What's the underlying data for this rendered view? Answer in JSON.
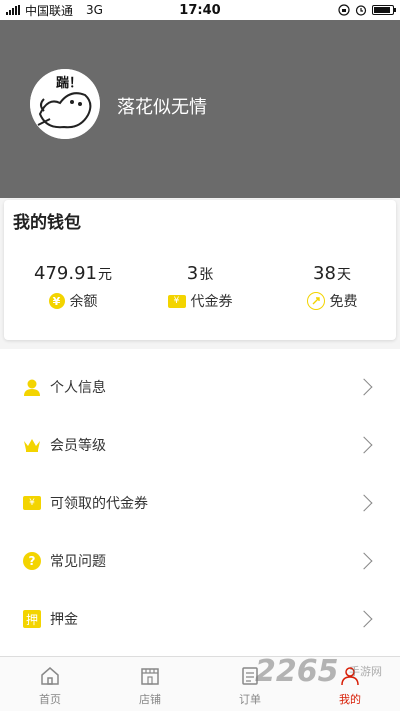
{
  "status_bar": {
    "carrier": "中国联通",
    "network": "3G",
    "time": "17:40",
    "battery_level": 0.8
  },
  "profile": {
    "username": "落花似无情",
    "avatar_text": "踹！"
  },
  "wallet": {
    "title": "我的钱包",
    "balance": {
      "value": "479.91",
      "unit": "元",
      "label": "余额",
      "icon": "yen-circle-icon",
      "icon_text": "¥"
    },
    "vouchers": {
      "value": "3",
      "unit": "张",
      "label": "代金券",
      "icon": "voucher-ticket-icon",
      "icon_text": "¥"
    },
    "free": {
      "value": "38",
      "unit": "天",
      "label": "免费",
      "icon": "free-days-icon"
    }
  },
  "menu": [
    {
      "label": "个人信息",
      "icon": "person-icon"
    },
    {
      "label": "会员等级",
      "icon": "crown-icon"
    },
    {
      "label": "可领取的代金券",
      "icon": "voucher-icon",
      "icon_text": "¥"
    },
    {
      "label": "常见问题",
      "icon": "question-icon",
      "icon_text": "?"
    },
    {
      "label": "押金",
      "icon": "deposit-icon",
      "icon_text": "押"
    }
  ],
  "tabbar": [
    {
      "label": "首页",
      "icon": "home-icon",
      "active": false
    },
    {
      "label": "店铺",
      "icon": "shop-icon",
      "active": false
    },
    {
      "label": "订单",
      "icon": "order-icon",
      "active": false
    },
    {
      "label": "我的",
      "icon": "profile-icon",
      "active": true
    }
  ],
  "watermark": {
    "text": "2265",
    "sub": "手游网"
  },
  "colors": {
    "accent": "#f3d400",
    "header_bg": "#6b6b6b",
    "active_tab": "#d81e06"
  }
}
